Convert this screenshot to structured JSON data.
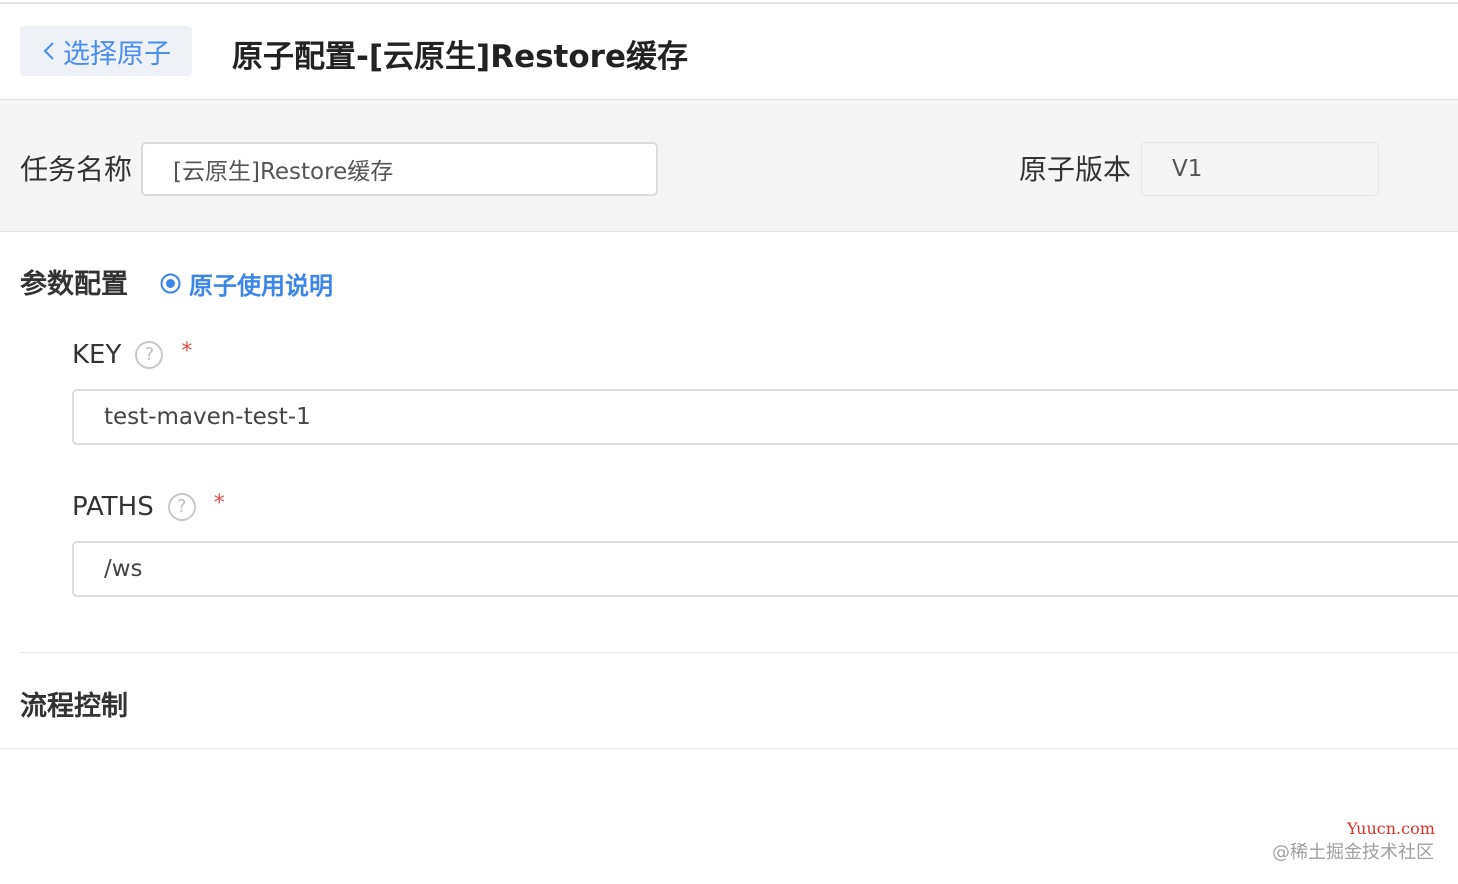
{
  "header": {
    "back_label": "选择原子",
    "title": "原子配置-[云原生]Restore缓存"
  },
  "basic": {
    "task_name_label": "任务名称",
    "task_name_value": "[云原生]Restore缓存",
    "version_label": "原子版本",
    "version_value": "V1"
  },
  "params": {
    "section_title": "参数配置",
    "doc_link_label": "原子使用说明",
    "fields": [
      {
        "label": "KEY",
        "required_mark": "*",
        "value": "test-maven-test-1"
      },
      {
        "label": "PATHS",
        "required_mark": "*",
        "value": "/ws"
      }
    ]
  },
  "flow": {
    "section_title": "流程控制"
  },
  "watermark": {
    "brand": "Yuucn.com",
    "site": "@稀土掘金技术社区"
  },
  "colors": {
    "accent": "#3c86e8",
    "required": "#e0504a",
    "band_bg": "#f5f5f5"
  }
}
